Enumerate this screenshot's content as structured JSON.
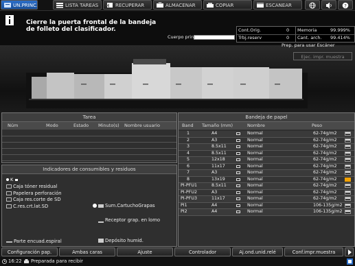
{
  "tabs": [
    {
      "label": "UN.PRINC.",
      "icon": "home-icon"
    },
    {
      "label": "LISTA TAREAS",
      "icon": "job-list-icon"
    },
    {
      "label": "RECUPERAR",
      "icon": "recall-icon"
    },
    {
      "label": "ALMACENAR",
      "icon": "store-icon"
    },
    {
      "label": "COPIAR",
      "icon": "copy-icon"
    },
    {
      "label": "ESCANEAR",
      "icon": "scan-icon"
    }
  ],
  "top_icons": [
    "globe-icon",
    "volume-icon",
    "help-icon"
  ],
  "message": {
    "icon": "info-icon",
    "line1": "Cierre la puerta frontal de la bandeja",
    "line2": "de folleto del clasificador."
  },
  "body_print": {
    "label": "Cuerpo prin.",
    "level_percent": 100
  },
  "counters": {
    "cont_orig_label": "Cont.Orig.",
    "cont_orig_value": "0",
    "trbj_reserv_label": "Trbj.reserv",
    "trbj_reserv_value": "0",
    "memoria_label": "Memoria",
    "memoria_value": "99.999%",
    "cant_arch_label": "Cant. arch.",
    "cant_arch_value": "99.414%"
  },
  "scanner_status": "Prep. para usar Escáner",
  "sample_button": "Ejec. impr. muestra",
  "task_panel": {
    "title": "Tarea",
    "columns": [
      "Núm",
      "Modo",
      "Estado",
      "Minuto(s)",
      "Nombre usuario"
    ]
  },
  "paper_panel": {
    "title": "Bandeja de papel",
    "columns": [
      "Band",
      "Tamaño (mm)",
      "Nombre",
      "Peso"
    ],
    "rows": [
      {
        "band": "1",
        "size": "A4",
        "name": "Normal",
        "weight": "62-74g/m2",
        "level": 0.6,
        "warn": false
      },
      {
        "band": "2",
        "size": "A3",
        "name": "Normal",
        "weight": "62-74g/m2",
        "level": 0.6,
        "warn": false
      },
      {
        "band": "3",
        "size": "8.5x11",
        "name": "Normal",
        "weight": "62-74g/m2",
        "level": 0.6,
        "warn": false
      },
      {
        "band": "4",
        "size": "8.5x11",
        "name": "Normal",
        "weight": "62-74g/m2",
        "level": 0.6,
        "warn": false
      },
      {
        "band": "5",
        "size": "12x18",
        "name": "Normal",
        "weight": "62-74g/m2",
        "level": 0.6,
        "warn": false
      },
      {
        "band": "6",
        "size": "11x17",
        "name": "Normal",
        "weight": "62-74g/m2",
        "level": 0.6,
        "warn": false
      },
      {
        "band": "7",
        "size": "A3",
        "name": "Normal",
        "weight": "62-74g/m2",
        "level": 0.6,
        "warn": false
      },
      {
        "band": "8",
        "size": "13x19",
        "name": "Normal",
        "weight": "62-74g/m2",
        "level": 0,
        "warn": true
      },
      {
        "band": "PI-PFU1",
        "size": "8.5x11",
        "name": "Normal",
        "weight": "62-74g/m2",
        "level": 0.6,
        "warn": false
      },
      {
        "band": "PI-PFU2",
        "size": "A3",
        "name": "Normal",
        "weight": "62-74g/m2",
        "level": 0.6,
        "warn": false
      },
      {
        "band": "PI-PFU3",
        "size": "11x17",
        "name": "Normal",
        "weight": "62-74g/m2",
        "level": 0.6,
        "warn": false
      },
      {
        "band": "PI1",
        "size": "A4",
        "name": "Normal",
        "weight": "106-135g/m2",
        "level": 0.6,
        "warn": false
      },
      {
        "band": "PI2",
        "size": "A4",
        "name": "Normal",
        "weight": "106-135g/m2",
        "level": 0.6,
        "warn": false
      }
    ]
  },
  "consumables_panel": {
    "title": "Indicadores de consumibles y residuos",
    "toner_label": "K",
    "left_items": [
      {
        "label": "Caja tóner residual",
        "icon": "waste-toner-icon"
      },
      {
        "label": "Papelera perforación",
        "icon": "punch-waste-icon"
      },
      {
        "label": "Caja res.corte de SD",
        "icon": "trim-waste-icon"
      },
      {
        "label": "C.res.crt.lat.SD",
        "icon": "side-trim-waste-icon"
      },
      {
        "label": "Parte encuad.espiral",
        "icon": "spiral-binding-icon"
      }
    ],
    "right_items": [
      {
        "label": "Sum.CartuchoGrapas",
        "icon": "staple-cartridge-icon"
      },
      {
        "label": "Receptor grap. en lomo",
        "icon": "staple-receiver-icon"
      },
      {
        "label": "Depósito humid.",
        "icon": "humidifier-tank-icon"
      }
    ]
  },
  "bottom_buttons": [
    "Configuración pap.",
    "Ambas caras",
    "Ajuste",
    "Controlador",
    "Aj.ond.unid.relé",
    "Conf.impr.muestra"
  ],
  "status": {
    "time": "16:22",
    "text": "Preparada para recibir"
  },
  "colors": {
    "active_tab": "#2c6fc9",
    "warning": "#f0a000",
    "panel": "#2f2f2f"
  }
}
